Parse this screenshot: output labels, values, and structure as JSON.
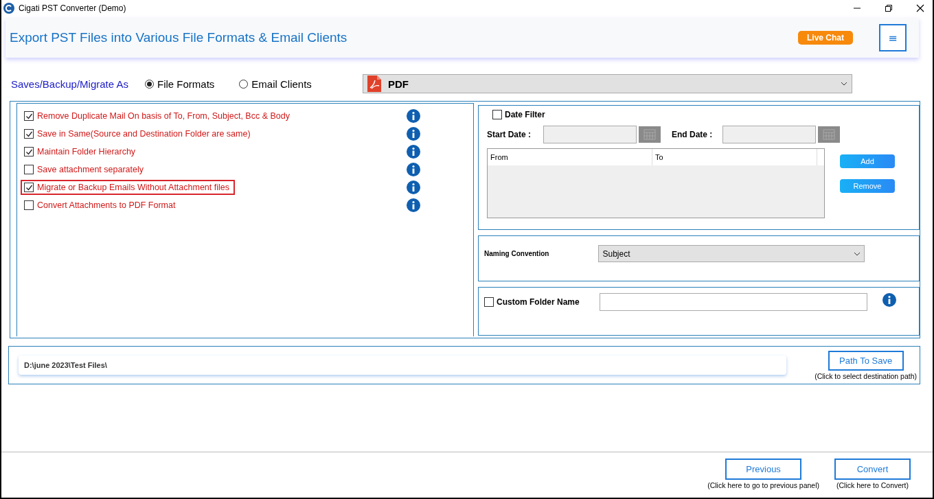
{
  "window": {
    "title": "Cigati PST Converter (Demo)"
  },
  "header": {
    "title": "Export PST Files into Various File Formats & Email Clients",
    "live_chat": "Live Chat",
    "menu_glyph": "≡"
  },
  "save_as": {
    "label": "Saves/Backup/Migrate As",
    "modes": [
      {
        "label": "File Formats",
        "selected": true
      },
      {
        "label": "Email Clients",
        "selected": false
      }
    ],
    "format": "PDF"
  },
  "options": [
    {
      "label": "Remove Duplicate Mail On basis of To, From, Subject, Bcc & Body",
      "checked": true,
      "highlighted": false
    },
    {
      "label": "Save in Same(Source and Destination Folder are same)",
      "checked": true,
      "highlighted": false
    },
    {
      "label": "Maintain Folder Hierarchy",
      "checked": true,
      "highlighted": false
    },
    {
      "label": "Save attachment separately",
      "checked": false,
      "highlighted": false
    },
    {
      "label": "Migrate or Backup Emails Without Attachment files",
      "checked": true,
      "highlighted": true
    },
    {
      "label": "Convert Attachments to PDF Format",
      "checked": false,
      "highlighted": false
    }
  ],
  "date_filter": {
    "label": "Date Filter",
    "checked": false,
    "start_label": "Start Date :",
    "end_label": "End Date :",
    "columns": [
      "From",
      "To"
    ],
    "add": "Add",
    "remove": "Remove"
  },
  "naming": {
    "label": "Naming Convention",
    "value": "Subject"
  },
  "custom_folder": {
    "label": "Custom Folder Name",
    "checked": false
  },
  "path": {
    "value": "D:\\june 2023\\Test Files\\",
    "button": "Path To Save",
    "hint": "(Click to select destination path)"
  },
  "footer": {
    "previous": "Previous",
    "previous_hint": "(Click here to go to previous panel)",
    "convert": "Convert",
    "convert_hint": "(Click here to Convert)"
  }
}
